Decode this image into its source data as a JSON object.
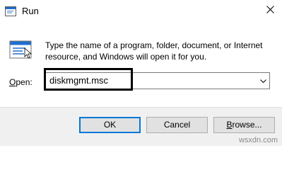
{
  "window": {
    "title": "Run",
    "close_glyph": "✕",
    "icon": "run-icon"
  },
  "dialog": {
    "description": "Type the name of a program, folder, document, or Internet resource, and Windows will open it for you.",
    "open_label_prefix": "O",
    "open_label_rest": "pen:",
    "command_value": "diskmgmt.msc",
    "dropdown_icon": "chevron-down-icon"
  },
  "buttons": {
    "ok": "OK",
    "cancel": "Cancel",
    "browse_prefix": "B",
    "browse_rest": "rowse..."
  },
  "watermark": "wsxdn.com",
  "colors": {
    "accent": "#0078d7",
    "footer_bg": "#f0f0f0",
    "button_bg": "#e1e1e1"
  }
}
